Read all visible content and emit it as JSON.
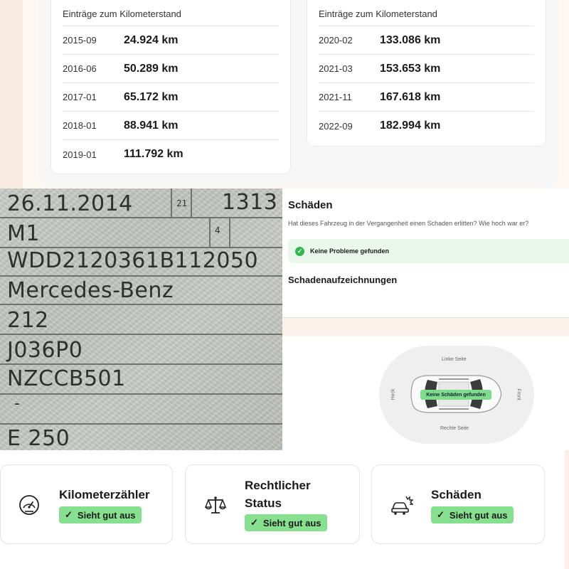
{
  "odometer": {
    "left_card": {
      "title": "Einträge zum Kilometerstand",
      "rows": [
        {
          "date": "2015-09",
          "km": "24.924 km"
        },
        {
          "date": "2016-06",
          "km": "50.289 km"
        },
        {
          "date": "2017-01",
          "km": "65.172 km"
        },
        {
          "date": "2018-01",
          "km": "88.941 km"
        },
        {
          "date": "2019-01",
          "km": "111.792 km"
        }
      ]
    },
    "right_card": {
      "title": "Einträge zum Kilometerstand",
      "rows": [
        {
          "date": "2020-02",
          "km": "133.086 km"
        },
        {
          "date": "2021-03",
          "km": "153.653 km"
        },
        {
          "date": "2021-11",
          "km": "167.618 km"
        },
        {
          "date": "2022-09",
          "km": "182.994 km"
        }
      ]
    }
  },
  "registration_document": {
    "first_registration": "26.11.2014",
    "field_21": "21",
    "field_1313": "1313",
    "vehicle_class": "M1",
    "field_4": "4",
    "vin": "WDD2120361B112050",
    "make": "Mercedes-Benz",
    "type": "212",
    "variant": "J036P0",
    "version": "NZCCB501",
    "dash": "-",
    "model": "E 250"
  },
  "damage": {
    "title": "Schäden",
    "question": "Hat dieses Fahrzeug in der Vergangenheit einen Schaden erlitten? Wie hoch war er?",
    "status": "Keine Probleme gefunden",
    "records_title": "Schadenaufzeichnungen",
    "car_view": {
      "left_side": "Linke Seite",
      "right_side": "Rechte Seite",
      "rear": "Heck",
      "front": "Front",
      "badge": "Keine Schäden gefunden"
    }
  },
  "status_cards": [
    {
      "icon": "speedometer-icon",
      "title": "Kilometerzähler",
      "badge": "Sieht gut aus"
    },
    {
      "icon": "scales-icon",
      "title": "Rechtlicher Status",
      "badge": "Sieht gut aus"
    },
    {
      "icon": "car-crash-icon",
      "title": "Schäden",
      "badge": "Sieht gut aus"
    }
  ],
  "colors": {
    "success_green": "#86e08f",
    "success_bg": "#eaf8ec",
    "check_green": "#2fb84f"
  }
}
